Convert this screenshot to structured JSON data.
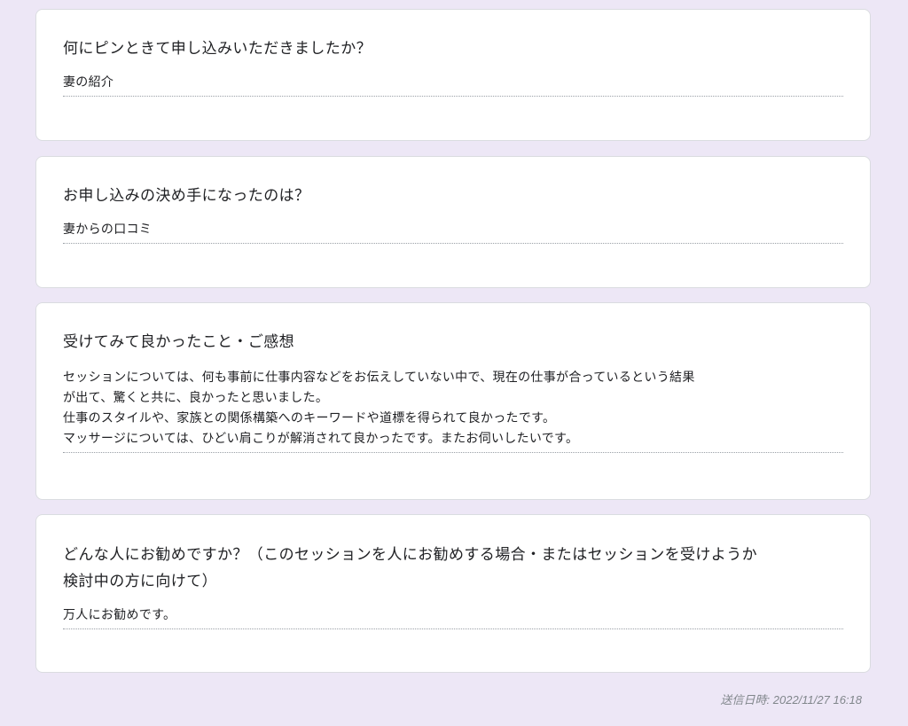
{
  "responses": [
    {
      "question": "何にピンときて申し込みいただきましたか？",
      "answer": "妻の紹介"
    },
    {
      "question": "お申し込みの決め手になったのは？",
      "answer": "妻からの口コミ"
    },
    {
      "question": "受けてみて良かったこと・ご感想",
      "answer": "セッションについては、何も事前に仕事内容などをお伝えしていない中で、現在の仕事が合っているという結果\nが出て、驚くと共に、良かったと思いました。\n仕事のスタイルや、家族との関係構築へのキーワードや道標を得られて良かったです。\nマッサージについては、ひどい肩こりが解消されて良かったです。またお伺いしたいです。"
    },
    {
      "question": "どんな人にお勧めですか？（このセッションを人にお勧めする場合・またはセッションを受けようか\n検討中の方に向けて）",
      "answer": "万人にお勧めです。"
    }
  ],
  "footer": {
    "timestamp": "送信日時: 2022/11/27 16:18"
  }
}
